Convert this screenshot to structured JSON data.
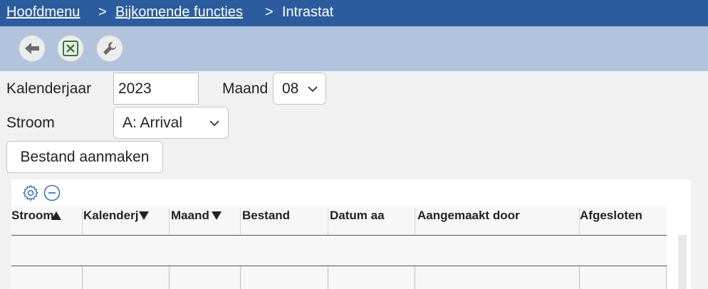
{
  "breadcrumb": {
    "items": [
      "Hoofdmenu",
      "Bijkomende functies",
      "Intrastat"
    ],
    "separator": ">"
  },
  "toolbar": {
    "buttons": [
      "back-arrow-icon",
      "excel-icon",
      "wrench-icon"
    ]
  },
  "form": {
    "year_label": "Kalenderjaar",
    "year_value": "2023",
    "month_label": "Maand",
    "month_value": "08",
    "flow_label": "Stroom",
    "flow_value": "A: Arrival",
    "create_button": "Bestand aanmaken"
  },
  "grid": {
    "columns": [
      {
        "label": "Stroom",
        "sort": "asc"
      },
      {
        "label": "Kalenderj",
        "sort": "desc"
      },
      {
        "label": "Maand",
        "sort": "desc"
      },
      {
        "label": "Bestand",
        "sort": ""
      },
      {
        "label": "Datum aa",
        "sort": ""
      },
      {
        "label": "Aangemaakt door",
        "sort": ""
      },
      {
        "label": "Afgesloten",
        "sort": ""
      }
    ]
  },
  "colors": {
    "header": "#2b5c9e",
    "toolbar": "#b2c3de",
    "accent_icon": "#3a78c2",
    "excel_green": "#2f7d3a"
  }
}
